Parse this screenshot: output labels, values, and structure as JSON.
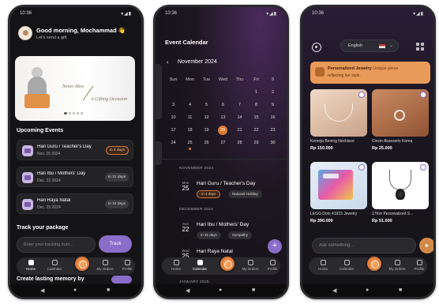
{
  "status": {
    "time": "10:36",
    "indicator": "G",
    "icons": "▾◢▮"
  },
  "nav_labels": [
    "Home",
    "Calendar",
    "",
    "My Orders",
    "Profile"
  ],
  "sysnav": [
    "◀",
    "●",
    "■"
  ],
  "home": {
    "greeting": "Good morning, Mochammad 👋",
    "subtitle": "Let's send a gift",
    "banner": {
      "text1": "Never Miss",
      "text2": "A Gifting Occasion"
    },
    "upcoming_title": "Upcoming Events",
    "events": [
      {
        "name": "Hari Guru / Teacher's Day",
        "date": "Nov. 25 2024",
        "badge": "In 4 days",
        "urgent": true
      },
      {
        "name": "Hari Ibu / Mothers' Day",
        "date": "Dec. 22 2024",
        "badge": "In 31 days",
        "urgent": false
      },
      {
        "name": "Hari Raya Natal",
        "date": "Dec. 25 2024",
        "badge": "In 34 days",
        "urgent": false
      }
    ],
    "track_title": "Track your package",
    "track_placeholder": "Enter your tracking num...",
    "track_button": "Track",
    "lasting": "Create lasting memory by"
  },
  "calendar": {
    "title": "Event Calendar",
    "month": "November 2024",
    "weekdays": [
      "Sun",
      "Mon",
      "Tue",
      "Wed",
      "Thu",
      "Fri",
      "S"
    ],
    "weeks": [
      [
        "",
        "",
        "",
        "",
        "",
        "1",
        "2"
      ],
      [
        "3",
        "4",
        "5",
        "6",
        "7",
        "8",
        "9"
      ],
      [
        "10",
        "11",
        "12",
        "13",
        "14",
        "15",
        "16"
      ],
      [
        "17",
        "18",
        "19",
        "20",
        "21",
        "22",
        "23"
      ],
      [
        "24",
        "25",
        "26",
        "27",
        "28",
        "29",
        "30"
      ]
    ],
    "today": "20",
    "marked": "25",
    "sections": [
      {
        "label": "NOVEMBER 2024",
        "dow": "Mon",
        "day": "25",
        "name": "Hari Guru / Teacher's Day",
        "chips": [
          "In 4 days",
          "National Holiday"
        ]
      },
      {
        "label": "DECEMBER 2024",
        "dow": "Sun",
        "day": "22",
        "name": "Hari Ibu / Mothers' Day",
        "chips": [
          "In 31 days",
          "Sympathy"
        ]
      },
      {
        "label": "",
        "dow": "Wed",
        "day": "25",
        "name": "Hari Raya Natal",
        "chips": []
      },
      {
        "label": "JANUARY 2025",
        "dow": "",
        "day": "",
        "name": "",
        "chips": []
      }
    ],
    "fab": "+"
  },
  "shop": {
    "language": "English",
    "promo_title": "Personalized Jewelry",
    "promo_tail": "Unique piece",
    "promo_sub": "reflecting her style.",
    "products": [
      {
        "name": "Kemeja Bening Necklace",
        "price": "Rp 150.000"
      },
      {
        "name": "Cincin Aksesoris Korea",
        "price": "Rp 25.000"
      },
      {
        "name": "LEGO Dots 41915 Jewelry",
        "price": "Rp 390.000"
      },
      {
        "name": "17Km Personalized S...",
        "price": "Rp 51.000"
      }
    ],
    "ask_placeholder": "Ask something...",
    "send": "►"
  }
}
